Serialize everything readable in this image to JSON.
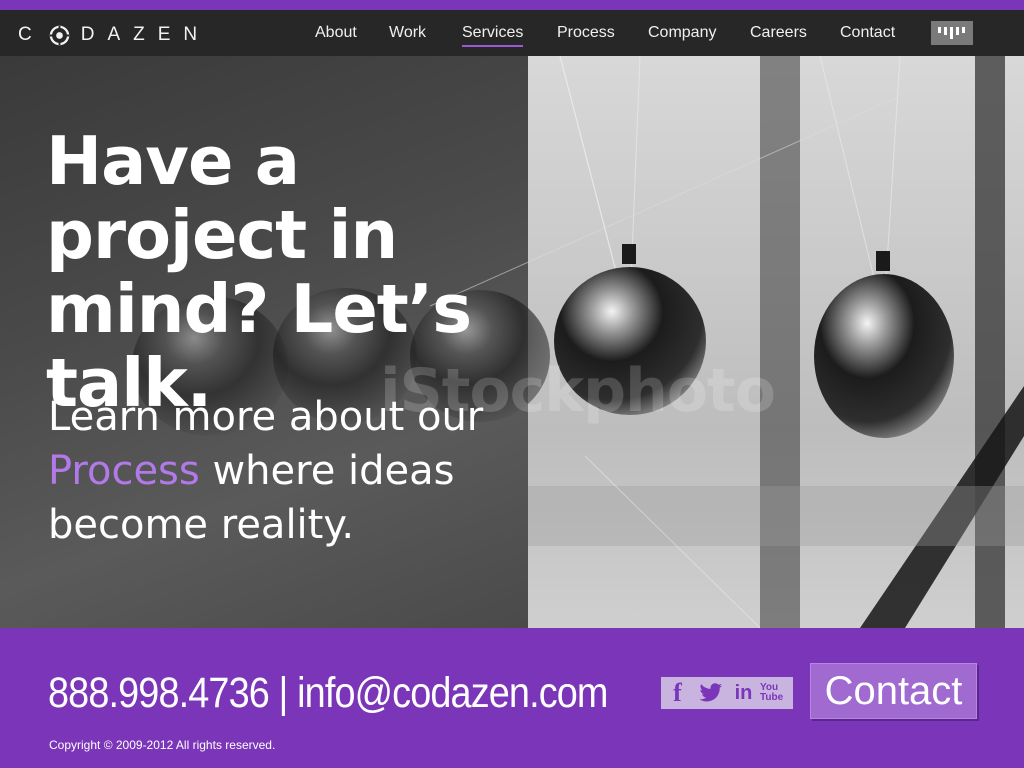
{
  "brand": {
    "name": "C DAZEN",
    "logo_icon": "target-o-icon"
  },
  "nav": {
    "items": [
      {
        "label": "About"
      },
      {
        "label": "Work"
      },
      {
        "label": "Services",
        "active": true
      },
      {
        "label": "Process"
      },
      {
        "label": "Company"
      },
      {
        "label": "Careers"
      },
      {
        "label": "Contact"
      }
    ],
    "badge_icon": "bars-logo-icon"
  },
  "hero": {
    "headline": "Have a project in mind? Let’s talk.",
    "sub_before": "Learn more about our",
    "sub_link": "Process",
    "sub_after": "where ideas become reality.",
    "watermark": "iStockphoto"
  },
  "footer": {
    "phone": "888.998.4736",
    "separator": "|",
    "email": "info@codazen.com",
    "social": [
      {
        "icon": "facebook-icon",
        "glyph": "f"
      },
      {
        "icon": "twitter-icon",
        "glyph": "t"
      },
      {
        "icon": "linkedin-icon",
        "glyph": "in"
      },
      {
        "icon": "youtube-icon",
        "glyph": "You Tube"
      }
    ],
    "contact_label": "Contact",
    "copyright": "Copyright © 2009-2012  All rights reserved."
  },
  "colors": {
    "brand_purple": "#7b35b8",
    "accent_text": "#b27ae8",
    "nav_bg": "#272727"
  }
}
